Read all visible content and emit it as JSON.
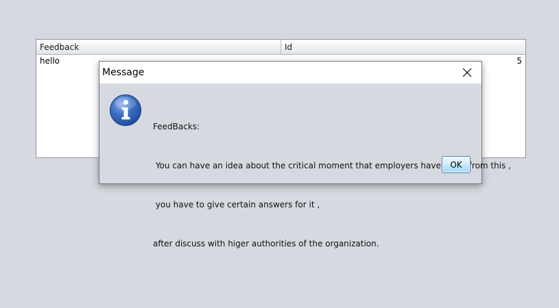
{
  "table": {
    "columns": [
      "Feedback",
      "Id"
    ],
    "rows": [
      {
        "feedback": "hello",
        "id": "5"
      }
    ]
  },
  "dialog": {
    "title": "Message",
    "icon": "info-icon",
    "message_lines": [
      "FeedBacks:",
      " You can have an idea about the critical moment that employers have faced from this ,",
      " you have to give certain answers for it ,",
      "after discuss with higer authorities of the organization."
    ],
    "ok_label": "OK",
    "close_symbol": "✕"
  },
  "colors": {
    "background": "#d6d9df",
    "info_icon_blue": "#2f63b6",
    "ok_border": "#3c7fb1"
  }
}
